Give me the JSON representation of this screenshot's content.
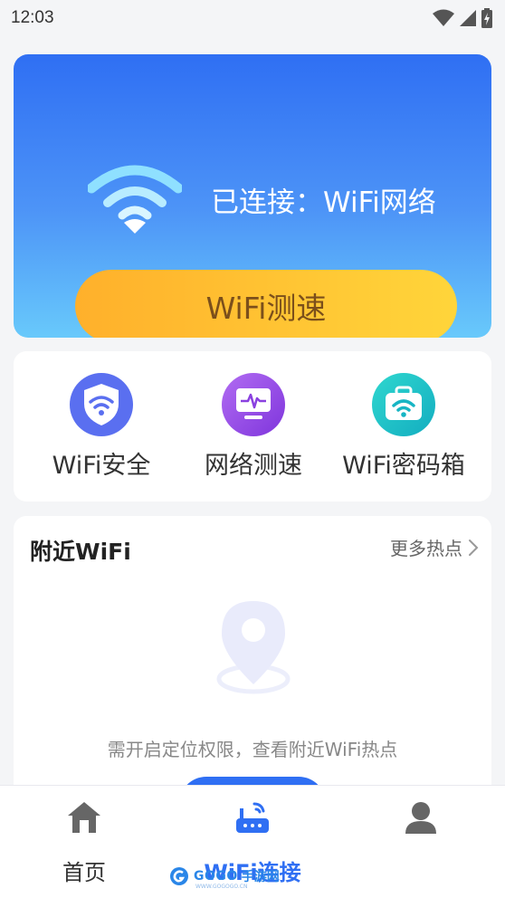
{
  "status_bar": {
    "time": "12:03",
    "icons": [
      "wifi-signal-icon",
      "cell-signal-icon",
      "battery-charging-icon"
    ]
  },
  "hero": {
    "status_text": "已连接：WiFi网络",
    "wifi_icon": "wifi-icon",
    "speed_test_label": "WiFi测速",
    "colors": {
      "gradient_top": "#2f6ff3",
      "gradient_bottom": "#68c9fb",
      "button": "#ffc233",
      "button_text": "#7b4f1b"
    }
  },
  "tools": [
    {
      "label": "WiFi安全",
      "icon": "shield-wifi-icon",
      "color": "#5a6ff0"
    },
    {
      "label": "网络测速",
      "icon": "monitor-pulse-icon",
      "color": "#9b4ee8"
    },
    {
      "label": "WiFi密码箱",
      "icon": "briefcase-wifi-icon",
      "color": "#1bbfc6"
    }
  ],
  "nearby": {
    "title": "附近WiFi",
    "more_label": "更多热点",
    "more_icon": "chevron-right-icon",
    "illustration_icon": "location-pin-icon",
    "hint": "需开启定位权限，查看附近WiFi热点"
  },
  "bottom_nav": {
    "active": "WiFi连接",
    "items": [
      {
        "label": "首页",
        "icon": "home-icon"
      },
      {
        "label": "WiFi连接",
        "icon": "router-icon"
      },
      {
        "label": "",
        "icon": "user-icon"
      }
    ]
  },
  "watermark": {
    "brand": "GOGO",
    "suffix": "手游网",
    "url": "WWW.GOGOGO.CN"
  }
}
